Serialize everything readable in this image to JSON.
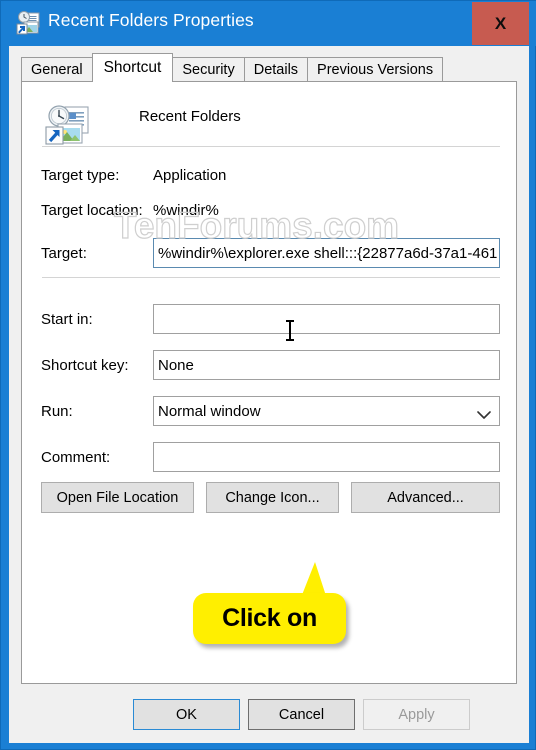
{
  "window": {
    "title": "Recent Folders Properties",
    "title_icon": "recent-folders-shortcut-icon",
    "close_label": "X",
    "accent_color": "#1a7fd4",
    "close_color": "#c75b50"
  },
  "tabs": [
    {
      "label": "General",
      "active": false
    },
    {
      "label": "Shortcut",
      "active": true
    },
    {
      "label": "Security",
      "active": false
    },
    {
      "label": "Details",
      "active": false
    },
    {
      "label": "Previous Versions",
      "active": false
    }
  ],
  "watermark": {
    "text": "TenForums.com",
    "color": "#cfcfcf"
  },
  "shortcut": {
    "name": "Recent Folders",
    "icon": "recent-folders-shortcut-icon",
    "info": [
      {
        "label": "Target type:",
        "value": "Application"
      },
      {
        "label": "Target location:",
        "value": "%windir%"
      }
    ],
    "fields": [
      {
        "label": "Target:",
        "value": "%windir%\\explorer.exe shell:::{22877a6d-37a1-461",
        "placeholder": "",
        "focused": true
      },
      {
        "label": "Start in:",
        "value": "",
        "placeholder": "",
        "focused": false
      },
      {
        "label": "Shortcut key:",
        "value": "None",
        "placeholder": "",
        "focused": false
      },
      {
        "label": "Comment:",
        "value": "",
        "placeholder": "",
        "focused": false
      }
    ],
    "run": {
      "label": "Run:",
      "value": "Normal window"
    },
    "buttons": [
      {
        "label": "Open File Location"
      },
      {
        "label": "Change Icon..."
      },
      {
        "label": "Advanced..."
      }
    ]
  },
  "callout": {
    "text": "Click on",
    "bg_color": "#ffef00"
  },
  "footer": {
    "ok": "OK",
    "cancel": "Cancel",
    "apply": "Apply"
  }
}
